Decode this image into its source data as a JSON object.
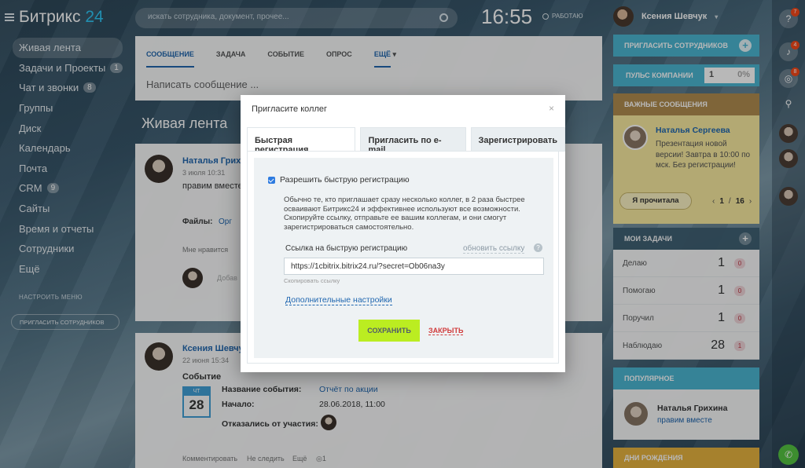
{
  "app": {
    "logo_main": "Битрикс",
    "logo_accent": "24"
  },
  "sidebar": {
    "items": [
      {
        "label": "Живая лента",
        "counter": ""
      },
      {
        "label": "Задачи и Проекты",
        "counter": "1"
      },
      {
        "label": "Чат и звонки",
        "counter": "8"
      },
      {
        "label": "Группы",
        "counter": ""
      },
      {
        "label": "Диск",
        "counter": ""
      },
      {
        "label": "Календарь",
        "counter": ""
      },
      {
        "label": "Почта",
        "counter": ""
      },
      {
        "label": "CRM",
        "counter": "9"
      },
      {
        "label": "Сайты",
        "counter": ""
      },
      {
        "label": "Время и отчеты",
        "counter": ""
      },
      {
        "label": "Сотрудники",
        "counter": ""
      },
      {
        "label": "Ещё",
        "counter": ""
      }
    ],
    "settings": "НАСТРОИТЬ МЕНЮ",
    "invite": "ПРИГЛАСИТЬ СОТРУДНИКОВ"
  },
  "topbar": {
    "search_placeholder": "искать сотрудника, документ, прочее...",
    "clock": "16:55",
    "status": "РАБОТАЮ",
    "user_name": "Ксения Шевчук"
  },
  "composer": {
    "tabs": [
      "СООБЩЕНИЕ",
      "ЗАДАЧА",
      "СОБЫТИЕ",
      "ОПРОС",
      "ЕЩЁ"
    ],
    "placeholder": "Написать сообщение ..."
  },
  "feed": {
    "title": "Живая лента",
    "post1": {
      "author": "Наталья Грихи",
      "date": "3 июля 10:31",
      "text": "правим вместе",
      "files_label": "Файлы:",
      "file": "Орг",
      "like": "Мне нравится",
      "comment_placeholder": "Добав"
    },
    "post2": {
      "author": "Ксения Шевчук",
      "date": "22 июня 15:34",
      "type": "Событие",
      "weekday": "ЧТ",
      "day": "28",
      "event_name_label": "Название события:",
      "event_name": "Отчёт по акции",
      "start_label": "Начало:",
      "start": "28.06.2018, 11:00",
      "declined_label": "Отказались от участия:",
      "actions": [
        "Комментировать",
        "Не следить",
        "Ещё"
      ],
      "views": "1"
    }
  },
  "modal": {
    "title": "Пригласите коллег",
    "close": "×",
    "tabs": [
      "Быстрая регистрация",
      "Пригласить по e-mail",
      "Зарегистрировать"
    ],
    "checkbox_label": "Разрешить быструю регистрацию",
    "description": "Обычно те, кто приглашает сразу несколько коллег, в 2 раза быстрее осваивают Битрикс24 и эффективнее используют все возможности. Скопируйте ссылку, отправьте ее вашим коллегам, и они смогут зарегистрироваться самостоятельно.",
    "link_label": "Ссылка на быструю регистрацию",
    "refresh_link": "обновить ссылку",
    "help": "?",
    "url": "https://1cbitrix.bitrix24.ru/?secret=Ob06na3y",
    "copy_hint": "Скопировать ссылку",
    "advanced": "Дополнительные настройки",
    "save": "СОХРАНИТЬ",
    "cancel": "ЗАКРЫТЬ"
  },
  "right": {
    "invite": "ПРИГЛАСИТЬ СОТРУДНИКОВ",
    "pulse_label": "ПУЛЬС КОМПАНИИ",
    "pulse_value": "1",
    "pulse_percent": "0%",
    "important_title": "ВАЖНЫЕ СООБЩЕНИЯ",
    "important_author": "Наталья Сергеева",
    "important_text": "Презентация новой версии! Завтра в 10:00 по мск. Без регистрации!",
    "read_button": "Я прочитала",
    "page_current": "1",
    "page_total": "16",
    "tasks_title": "МОИ ЗАДАЧИ",
    "tasks": [
      {
        "label": "Делаю",
        "count": "1",
        "badge": "0"
      },
      {
        "label": "Помогаю",
        "count": "1",
        "badge": "0"
      },
      {
        "label": "Поручил",
        "count": "1",
        "badge": "0"
      },
      {
        "label": "Наблюдаю",
        "count": "28",
        "badge": "1"
      }
    ],
    "popular_title": "ПОПУЛЯРНОЕ",
    "popular_author": "Наталья Грихина",
    "popular_text": "правим вместе",
    "birthdays_title": "ДНИ РОЖДЕНИЯ"
  },
  "strip": {
    "badge_help": "7",
    "badge_bell": "4",
    "badge_chat": "8"
  },
  "colors": {
    "accent": "#2fc6f6",
    "link": "#2067b0",
    "save": "#bbed21",
    "danger": "#d13b3b",
    "important": "#f8eba0"
  }
}
